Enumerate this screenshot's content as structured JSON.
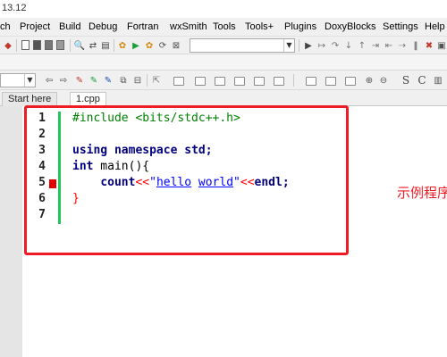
{
  "window": {
    "title": "13.12"
  },
  "menu": [
    "ch",
    "Project",
    "Build",
    "Debug",
    "Fortran",
    "wxSmith",
    "Tools",
    "Tools+",
    "Plugins",
    "DoxyBlocks",
    "Settings",
    "Help"
  ],
  "tabs": [
    {
      "label": "Start here",
      "active": false
    },
    {
      "label": "1.cpp",
      "active": true
    }
  ],
  "editor": {
    "line_numbers": [
      "1",
      "2",
      "3",
      "4",
      "5",
      "6",
      "7"
    ],
    "breakpoint_line": 5,
    "lines": {
      "l1": "#include <bits/stdc++.h>",
      "l3_kw1": "using",
      "l3_kw2": "namespace",
      "l3_id": "std",
      "l3_end": ";",
      "l4_kw": "int",
      "l4_rest": " main(){",
      "l5_indent": "    ",
      "l5_id": "count",
      "l5_op1": "<<",
      "l5_q1": "\"",
      "l5_str1": "hello",
      "l5_sp": " ",
      "l5_str2": "world",
      "l5_q2": "\"",
      "l5_op2": "<<",
      "l5_id2": "endl",
      "l5_end": ";",
      "l6": "}"
    }
  },
  "annotation": {
    "text": "示例程序"
  },
  "colors": {
    "annotation_red": "#ee1c24",
    "keyword": "#000080",
    "preprocessor": "#008000",
    "string": "#0000ff",
    "operator": "#ff0000",
    "change_bar": "#22c55e",
    "breakpoint": "#e00000"
  }
}
